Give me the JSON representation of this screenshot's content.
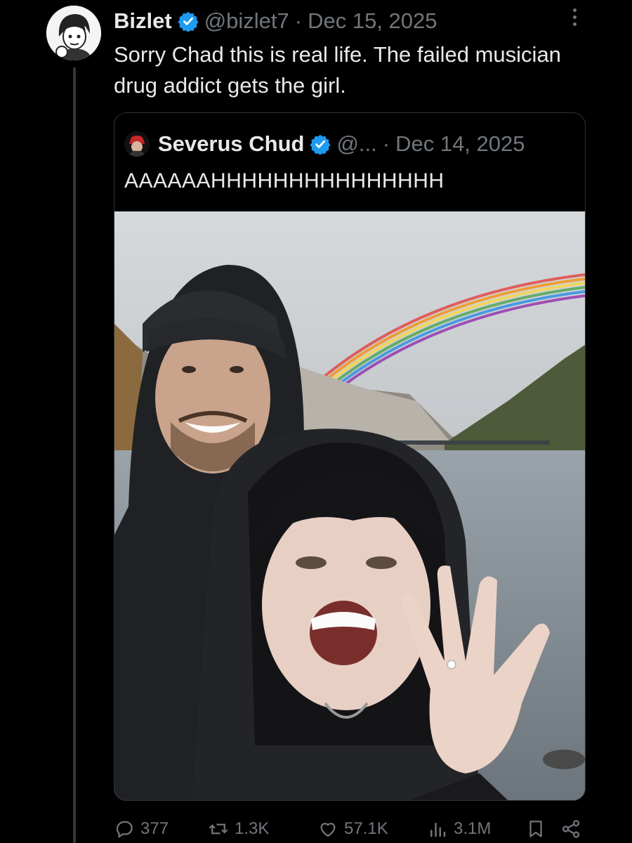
{
  "tweet": {
    "author_name": "Bizlet",
    "handle": "@bizlet7",
    "separator": "·",
    "date": "Dec 15, 2025",
    "text": "Sorry Chad this is real life. The failed musician drug addict gets the girl.",
    "avatar_icon": "anime-avatar-icon",
    "verified_icon": "verified-badge-icon",
    "accent_color": "#1d9bf0"
  },
  "quote": {
    "author_name": "Severus Chud",
    "handle": "@...",
    "separator": "·",
    "date": "Dec 14, 2025",
    "text": "AAAAAAHHHHHHHHHHHHHHH",
    "avatar_icon": "quoted-avatar-icon",
    "photo_icon": "selfie-photo-rainbow-lake"
  },
  "actions": {
    "replies": "377",
    "reposts": "1.3K",
    "likes": "57.1K",
    "views": "3.1M",
    "reply_icon": "reply-icon",
    "repost_icon": "repost-icon",
    "like_icon": "heart-icon",
    "views_icon": "views-icon",
    "bookmark_icon": "bookmark-icon",
    "share_icon": "share-icon"
  }
}
